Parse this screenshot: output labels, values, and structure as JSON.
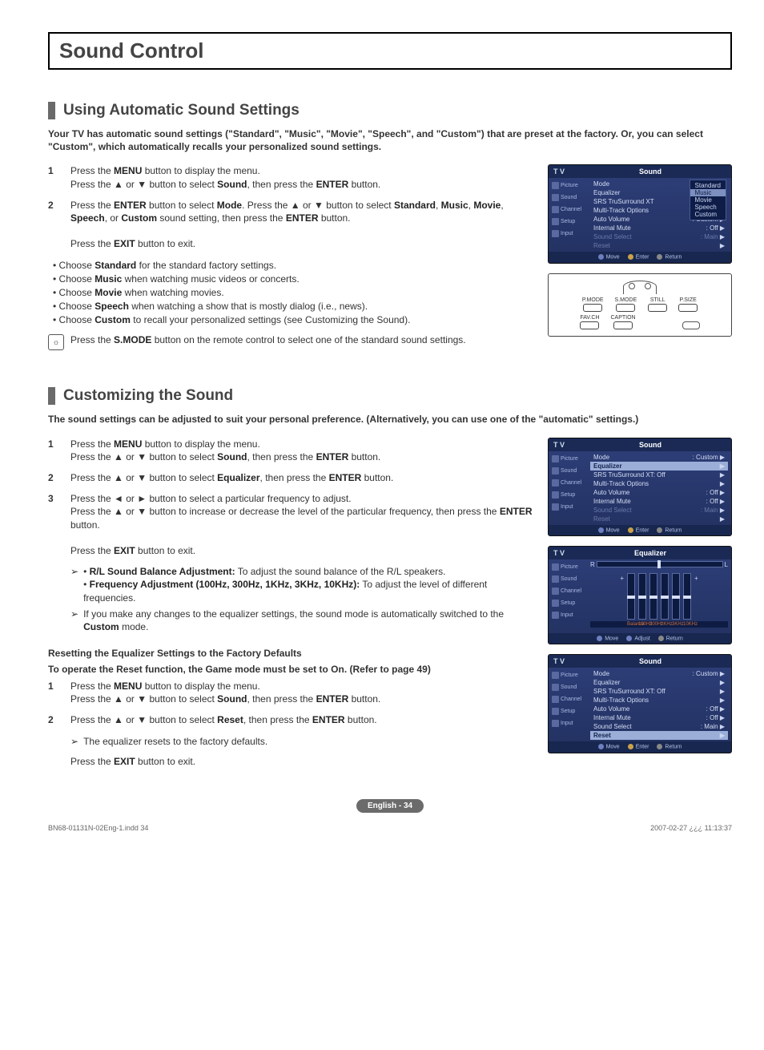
{
  "title": "Sound Control",
  "section1": {
    "heading": "Using Automatic Sound Settings",
    "intro": "Your TV has automatic sound settings (\"Standard\", \"Music\", \"Movie\", \"Speech\", and \"Custom\") that are preset at the factory. Or, you can select \"Custom\", which automatically recalls your personalized sound settings.",
    "steps": [
      {
        "n": "1",
        "html": "Press the <b>MENU</b> button to display the menu.<br>Press the ▲ or ▼ button to select <b>Sound</b>, then press the <b>ENTER</b> button."
      },
      {
        "n": "2",
        "html": "Press the <b>ENTER</b> button to select <b>Mode</b>. Press the ▲ or ▼ button to select <b>Standard</b>, <b>Music</b>, <b>Movie</b>, <b>Speech</b>, or <b>Custom</b> sound setting, then press the <b>ENTER</b> button.<br><br>Press the <b>EXIT</b> button to exit."
      }
    ],
    "bullets": [
      "Choose <b>Standard</b> for the standard factory settings.",
      "Choose <b>Music</b> when watching music videos or concerts.",
      "Choose <b>Movie</b> when watching movies.",
      "Choose <b>Speech</b> when watching a show that is mostly dialog (i.e., news).",
      "Choose <b>Custom</b> to recall your personalized settings (see Customizing the Sound)."
    ],
    "note": "Press the <b>S.MODE</b> button on the remote control to select one of the standard sound settings."
  },
  "section2": {
    "heading": "Customizing the Sound",
    "intro": "The sound settings can be adjusted to suit your personal preference. (Alternatively, you can use one of the \"automatic\" settings.)",
    "steps": [
      {
        "n": "1",
        "html": "Press the <b>MENU</b> button to display the menu.<br>Press the ▲ or ▼ button to select <b>Sound</b>, then press the <b>ENTER</b> button."
      },
      {
        "n": "2",
        "html": "Press the ▲ or ▼ button to select <b>Equalizer</b>, then press the <b>ENTER</b> button."
      },
      {
        "n": "3",
        "html": "Press the ◄ or ► button to select a particular frequency to adjust.<br>Press the ▲ or ▼ button to increase or decrease the level of the particular frequency, then press the <b>ENTER</b> button.<br><br>Press the <b>EXIT</b> button to exit."
      }
    ],
    "arrows": [
      "• <b>R/L Sound Balance Adjustment:</b> To adjust the sound balance of the R/L speakers.<br>• <b>Frequency Adjustment (100Hz, 300Hz, 1KHz, 3KHz, 10KHz):</b> To adjust the level of different frequencies.",
      "If you make any changes to the equalizer settings, the sound mode is automatically switched to the <b>Custom</b> mode."
    ],
    "reset_heading": "Resetting the Equalizer Settings to the Factory Defaults",
    "reset_intro": "To operate the Reset function, the Game mode must be set to On. (Refer to page 49)",
    "reset_steps": [
      {
        "n": "1",
        "html": "Press the <b>MENU</b> button to display the menu.<br>Press the ▲ or ▼ button to select <b>Sound</b>, then press the <b>ENTER</b> button."
      },
      {
        "n": "2",
        "html": "Press the ▲ or ▼ button to select <b>Reset</b>, then press the <b>ENTER</b> button."
      }
    ],
    "reset_arrow": "The equalizer resets to the factory defaults.",
    "reset_exit": "Press the <b>EXIT</b> button to exit."
  },
  "osd_sidebar": [
    "Picture",
    "Sound",
    "Channel",
    "Setup",
    "Input"
  ],
  "osd1": {
    "tv": "T V",
    "title": "Sound",
    "rows": [
      {
        "l": "Mode",
        "r": ""
      },
      {
        "l": "Equalizer",
        "r": ""
      },
      {
        "l": "SRS TruSurround XT",
        "r": ": Movie"
      },
      {
        "l": "Multi-Track Options",
        "r": ""
      },
      {
        "l": "Auto Volume",
        "r": ": Custom"
      },
      {
        "l": "Internal Mute",
        "r": ": Off"
      },
      {
        "l": "Sound Select",
        "r": ": Main",
        "dim": true
      },
      {
        "l": "Reset",
        "r": "",
        "dim": true
      }
    ],
    "opts": [
      "Standard",
      "Music",
      "Movie",
      "Speech",
      "Custom"
    ],
    "opt_sel": 1,
    "ftr": {
      "move": "Move",
      "enter": "Enter",
      "return": "Return"
    }
  },
  "osd2": {
    "tv": "T V",
    "title": "Sound",
    "rows": [
      {
        "l": "Mode",
        "r": ": Custom"
      },
      {
        "l": "Equalizer",
        "r": "",
        "hi": true
      },
      {
        "l": "SRS TruSurround XT: Off",
        "r": ""
      },
      {
        "l": "Multi-Track Options",
        "r": ""
      },
      {
        "l": "Auto Volume",
        "r": ": Off"
      },
      {
        "l": "Internal Mute",
        "r": ": Off"
      },
      {
        "l": "Sound Select",
        "r": ": Main",
        "dim": true
      },
      {
        "l": "Reset",
        "r": "",
        "dim": true
      }
    ],
    "ftr": {
      "move": "Move",
      "enter": "Enter",
      "return": "Return"
    }
  },
  "osd3": {
    "tv": "T V",
    "title": "Equalizer",
    "labels": [
      "Balance",
      "100Hz",
      "300Hz",
      "1KHz",
      "3KHz",
      "10KHz"
    ],
    "ftr": {
      "move": "Move",
      "adjust": "Adjust",
      "return": "Return"
    }
  },
  "osd4": {
    "tv": "T V",
    "title": "Sound",
    "rows": [
      {
        "l": "Mode",
        "r": ": Custom"
      },
      {
        "l": "Equalizer",
        "r": ""
      },
      {
        "l": "SRS TruSurround XT: Off",
        "r": ""
      },
      {
        "l": "Multi-Track Options",
        "r": ""
      },
      {
        "l": "Auto Volume",
        "r": ": Off"
      },
      {
        "l": "Internal Mute",
        "r": ": Off"
      },
      {
        "l": "Sound Select",
        "r": ": Main"
      },
      {
        "l": "Reset",
        "r": "",
        "hi": true
      }
    ],
    "ftr": {
      "move": "Move",
      "enter": "Enter",
      "return": "Return"
    }
  },
  "remote": {
    "row1": [
      "P.MODE",
      "S.MODE",
      "STILL",
      "P.SIZE"
    ],
    "row2": [
      "FAV.CH",
      "CAPTION"
    ]
  },
  "page_badge": "English - 34",
  "footer": {
    "left": "BN68-01131N-02Eng-1.indd   34",
    "right": "2007-02-27   ¿¿¿ 11:13:37"
  }
}
